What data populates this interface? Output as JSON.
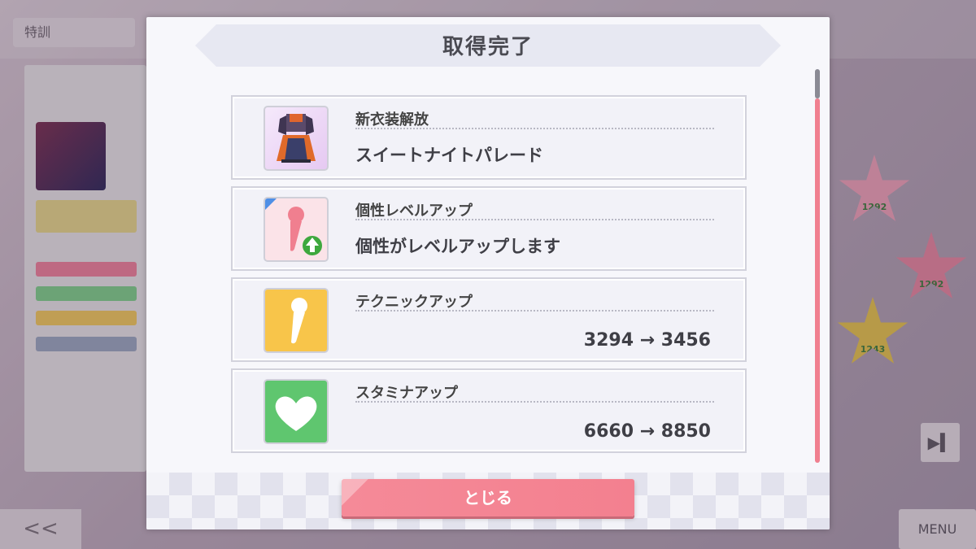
{
  "background": {
    "tab_label": "特訓",
    "left_nav": "<<",
    "menu_label": "MENU",
    "star_labels": [
      "1292",
      "1292",
      "1243"
    ]
  },
  "modal": {
    "title": "取得完了",
    "items": [
      {
        "name": "新衣装解放",
        "desc": "スイートナイトパレード",
        "value": "",
        "icon": "costume-icon"
      },
      {
        "name": "個性レベルアップ",
        "desc": "個性がレベルアップします",
        "value": "",
        "icon": "microphone-level-up-icon"
      },
      {
        "name": "テクニックアップ",
        "desc": "",
        "value": "3294 → 3456",
        "icon": "microphone-icon"
      },
      {
        "name": "スタミナアップ",
        "desc": "",
        "value": "6660 → 8850",
        "icon": "heart-icon"
      }
    ],
    "close_label": "とじる"
  },
  "colors": {
    "accent": "#f3808f",
    "technique": "#f8c54a",
    "stamina": "#5fc66f",
    "skill": "#f07f8f"
  }
}
